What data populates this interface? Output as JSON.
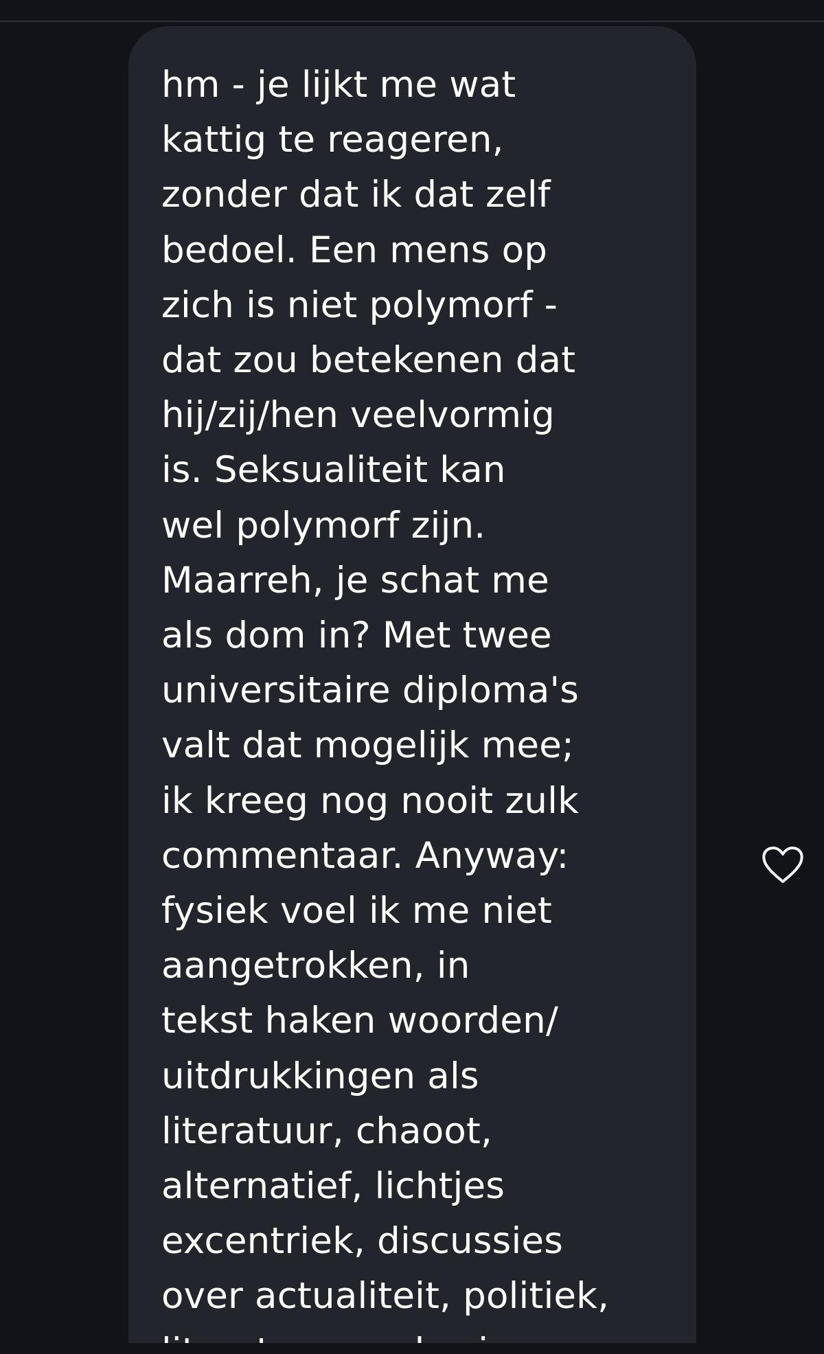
{
  "message": {
    "text": "hm - je lijkt me wat\nkattig te reageren,\nzonder dat ik dat zelf\nbedoel. Een mens op\nzich is niet polymorf -\ndat zou betekenen dat\nhij/zij/hen veelvormig\nis. Seksualiteit kan\nwel polymorf zijn.\nMaarreh, je schat me\nals dom in? Met twee\nuniversitaire diploma's\nvalt dat mogelijk mee;\nik kreeg nog nooit zulk\ncommentaar. Anyway:\nfysiek voel ik me niet\naangetrokken, in\ntekst haken woorden/\nuitdrukkingen als\nliteratuur, chaoot,\nalternatief, lichtjes\nexcentriek, discussies\nover actualiteit, politiek,\nliteratuur en de zin"
  },
  "icons": {
    "like": "heart-outline-icon"
  },
  "colors": {
    "background": "#111319",
    "bubble": "#23252c",
    "text": "#ffffff",
    "icon": "#f3f3f3"
  }
}
